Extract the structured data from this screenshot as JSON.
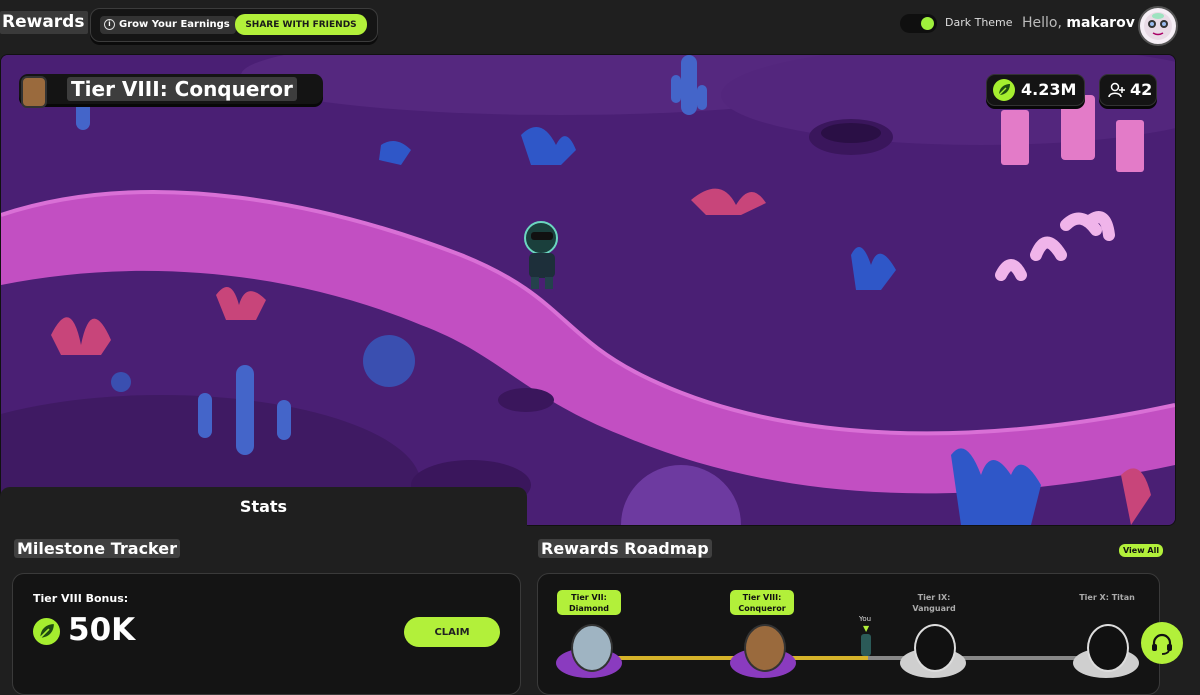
{
  "header": {
    "app_title": "Rewards",
    "grow_label": "Grow Your Earnings",
    "share_button": "SHARE WITH FRIENDS",
    "theme_label": "Dark Theme",
    "theme_enabled": true,
    "greeting_prefix": "Hello,",
    "username": "makarov"
  },
  "scene": {
    "tier_title": "Tier VIII: Conqueror",
    "earnings": "4.23M",
    "friends_count": "42"
  },
  "stats_tab": "Stats",
  "milestone": {
    "title": "Milestone Tracker",
    "bonus_label": "Tier VIII Bonus:",
    "bonus_amount": "50K",
    "claim_button": "CLAIM"
  },
  "roadmap": {
    "title": "Rewards Roadmap",
    "view_all": "View All",
    "you_label": "You",
    "tiers": [
      {
        "line1": "Tier VII:",
        "line2": "Diamond",
        "unlocked": true
      },
      {
        "line1": "Tier VIII:",
        "line2": "Conqueror",
        "unlocked": true
      },
      {
        "line1": "Tier IX:",
        "line2": "Vanguard",
        "unlocked": false
      },
      {
        "line1": "Tier X: Titan",
        "line2": "",
        "unlocked": false
      }
    ]
  },
  "colors": {
    "accent": "#b2f03a",
    "background": "#1f1f1f",
    "card": "#141414",
    "scene_purple": "#47206e",
    "path_pink": "#c24fc2"
  },
  "icons": {
    "info": "info-icon",
    "leaf": "leaf-icon",
    "friends": "add-user-icon",
    "support": "headset-icon"
  }
}
